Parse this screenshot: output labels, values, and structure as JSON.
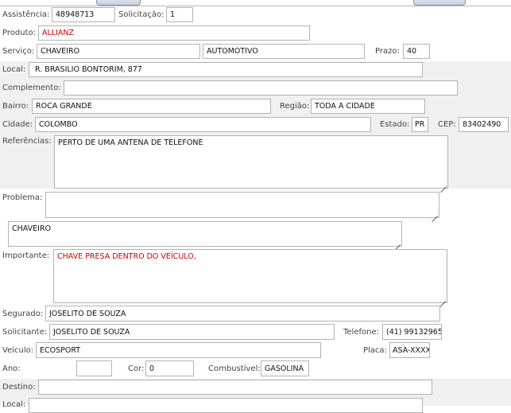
{
  "form": {
    "assistencia": {
      "label": "Assistência:",
      "value": "48948713"
    },
    "solicitacao": {
      "label": "Solicitação:",
      "value": "1"
    },
    "produto": {
      "label": "Produto:",
      "value": "ALLIANZ"
    },
    "servico": {
      "label": "Serviço:",
      "value": "CHAVEIRO",
      "value2": "AUTOMOTIVO"
    },
    "prazo": {
      "label": "Prazo:",
      "value": "40"
    },
    "local": {
      "label": "Local:",
      "value": "R. BRASILIO BONTORIM, 877"
    },
    "complemento": {
      "label": "Complemento:",
      "value": ""
    },
    "bairro": {
      "label": "Bairro:",
      "value": "ROCA GRANDE"
    },
    "regiao": {
      "label": "Região:",
      "value": "TODA A CIDADE"
    },
    "cidade": {
      "label": "Cidade:",
      "value": "COLOMBO"
    },
    "estado": {
      "label": "Estado:",
      "value": "PR"
    },
    "cep": {
      "label": "CEP:",
      "value": "83402490"
    },
    "referencias": {
      "label": "Referências:",
      "value": "PERTO DE UMA ANTENA DE TELEFONE"
    },
    "problema": {
      "label": "Problema:",
      "value": "",
      "value2": "CHAVEIRO"
    },
    "importante": {
      "label": "Importante:",
      "value": "CHAVE PRESA DENTRO DO VEÍCULO,"
    },
    "segurado": {
      "label": "Segurado:",
      "value": "JOSELITO DE SOUZA"
    },
    "solicitante": {
      "label": "Solicitante:",
      "value": "JOSELITO DE SOUZA"
    },
    "telefone": {
      "label": "Telefone:",
      "value": "(41) 99132965:"
    },
    "veiculo": {
      "label": "Veículo:",
      "value": "ECOSPORT"
    },
    "placa": {
      "label": "Placa:",
      "value": "ASA-XXXX"
    },
    "ano": {
      "label": "Ano:",
      "value": ""
    },
    "cor": {
      "label": "Cor:",
      "value": "0"
    },
    "combustivel": {
      "label": "Combustível:",
      "value": "GASOLINA"
    },
    "destino": {
      "label": "Destino:",
      "value": ""
    },
    "local2": {
      "label": "Local:",
      "value": ""
    }
  },
  "colors": {
    "band": "#f0f0f0",
    "border": "#b3b3b3",
    "highlight": "#d00000"
  }
}
